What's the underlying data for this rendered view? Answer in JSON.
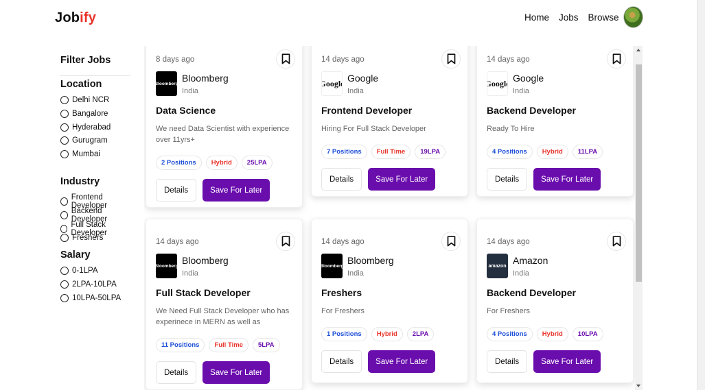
{
  "brand": {
    "logo_prefix": "Job",
    "logo_accent": "ify",
    "accent_color": "#e8342a",
    "primary_color": "#6a0dad"
  },
  "nav": {
    "home": "Home",
    "jobs": "Jobs",
    "browse": "Browse"
  },
  "filter": {
    "title": "Filter Jobs",
    "sections": [
      {
        "title": "Location",
        "options": [
          "Delhi NCR",
          "Bangalore",
          "Hyderabad",
          "Gurugram",
          "Mumbai"
        ]
      },
      {
        "title": "Industry",
        "options": [
          "Frontend Developer",
          "Backend Developer",
          "Full Stack Developer",
          "Freshers"
        ]
      },
      {
        "title": "Salary",
        "options": [
          "0-1LPA",
          "2LPA-10LPA",
          "10LPA-50LPA"
        ]
      }
    ]
  },
  "jobs": [
    {
      "time": "8 days ago",
      "company": "Bloomberg",
      "logo_text": "Bloomberg",
      "logo_type": "bloomberg",
      "country": "India",
      "title": "Data Science",
      "description": "We need Data Scientist with experience over 11yrs+",
      "positions": "2 Positions",
      "type": "Hybrid",
      "salary": "25LPA"
    },
    {
      "time": "14 days ago",
      "company": "Google",
      "logo_text": "Google",
      "logo_type": "google",
      "country": "India",
      "title": "Frontend Developer",
      "description": "Hiring For Full Stack Developer",
      "positions": "7 Positions",
      "type": "Full Time",
      "salary": "19LPA"
    },
    {
      "time": "14 days ago",
      "company": "Google",
      "logo_text": "Google",
      "logo_type": "google",
      "country": "India",
      "title": "Backend Developer",
      "description": "Ready To Hire",
      "positions": "4 Positions",
      "type": "Hybrid",
      "salary": "11LPA"
    },
    {
      "time": "14 days ago",
      "company": "Bloomberg",
      "logo_text": "Bloomberg",
      "logo_type": "bloomberg",
      "country": "India",
      "title": "Full Stack Developer",
      "description": "We Need Full Stack Developer who has experinece in MERN as well as",
      "positions": "11 Positions",
      "type": "Full Time",
      "salary": "5LPA"
    },
    {
      "time": "14 days ago",
      "company": "Bloomberg",
      "logo_text": "Bloomberg",
      "logo_type": "bloomberg",
      "country": "India",
      "title": "Freshers",
      "description": "For Freshers",
      "positions": "1 Positions",
      "type": "Hybrid",
      "salary": "2LPA"
    },
    {
      "time": "14 days ago",
      "company": "Amazon",
      "logo_text": "amazon",
      "logo_type": "amazon",
      "country": "India",
      "title": "Backend Developer",
      "description": "For Freshers",
      "positions": "4 Positions",
      "type": "Hybrid",
      "salary": "10LPA"
    }
  ],
  "buttons": {
    "details": "Details",
    "save": "Save For Later"
  },
  "icons": {
    "bookmark": "bookmark-icon",
    "radio": "radio-icon"
  }
}
